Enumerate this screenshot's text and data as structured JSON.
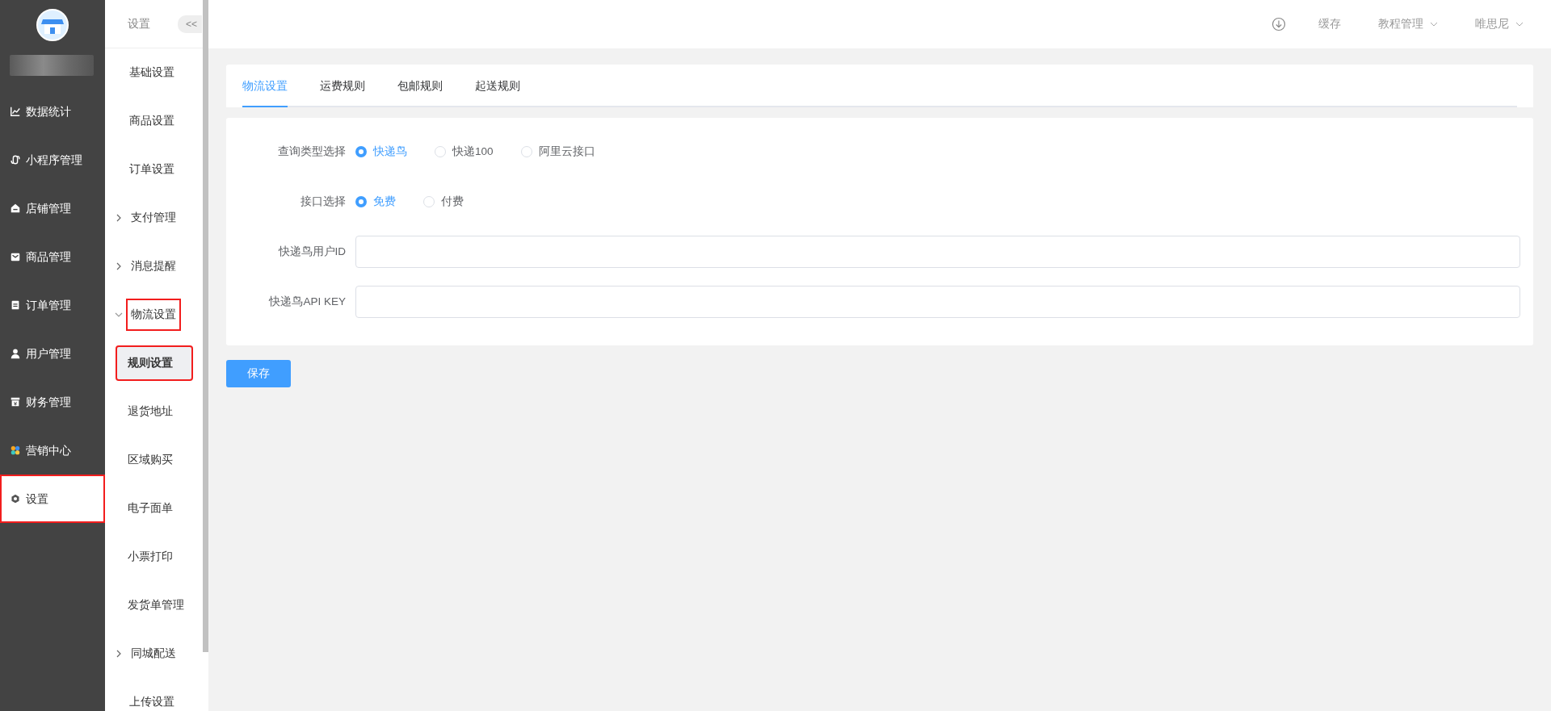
{
  "main_menu": [
    {
      "label": "数据统计",
      "kind": "chart",
      "selected": false,
      "highlighted": false
    },
    {
      "label": "小程序管理",
      "kind": "link",
      "selected": false,
      "highlighted": false
    },
    {
      "label": "店铺管理",
      "kind": "store",
      "selected": false,
      "highlighted": false
    },
    {
      "label": "商品管理",
      "kind": "mail",
      "selected": false,
      "highlighted": false
    },
    {
      "label": "订单管理",
      "kind": "clipboard",
      "selected": false,
      "highlighted": false
    },
    {
      "label": "用户管理",
      "kind": "user",
      "selected": false,
      "highlighted": false
    },
    {
      "label": "财务管理",
      "kind": "finance",
      "selected": false,
      "highlighted": false
    },
    {
      "label": "营销中心",
      "kind": "marketing",
      "selected": false,
      "highlighted": false
    },
    {
      "label": "设置",
      "kind": "settings",
      "selected": true,
      "highlighted": true
    }
  ],
  "sub_menu": {
    "title": "设置",
    "collapse_button": "<<",
    "items": [
      {
        "label": "基础设置",
        "selected": false,
        "highlighted": false
      },
      {
        "label": "商品设置",
        "selected": false,
        "highlighted": false
      },
      {
        "label": "订单设置",
        "selected": false,
        "highlighted": false
      },
      {
        "label": "支付管理",
        "expanded": false,
        "highlighted": false
      },
      {
        "label": "消息提醒",
        "expanded": false,
        "highlighted": false
      },
      {
        "label": "物流设置",
        "expanded": true,
        "highlighted": true,
        "children": [
          {
            "label": "规则设置",
            "selected": true,
            "highlighted": true
          },
          {
            "label": "退货地址",
            "selected": false,
            "highlighted": false
          },
          {
            "label": "区域购买",
            "selected": false,
            "highlighted": false
          },
          {
            "label": "电子面单",
            "selected": false,
            "highlighted": false
          },
          {
            "label": "小票打印",
            "selected": false,
            "highlighted": false
          },
          {
            "label": "发货单管理",
            "selected": false,
            "highlighted": false
          }
        ]
      },
      {
        "label": "同城配送",
        "expanded": false,
        "highlighted": false
      },
      {
        "label": "上传设置",
        "selected": false,
        "highlighted": false
      }
    ]
  },
  "top_bar": {
    "items": [
      {
        "label": "缓存",
        "dropdown": false
      },
      {
        "label": "教程管理",
        "dropdown": true
      },
      {
        "label": "唯思尼",
        "dropdown": true
      }
    ]
  },
  "tabs": [
    {
      "label": "物流设置",
      "selected": true
    },
    {
      "label": "运费规则",
      "selected": false
    },
    {
      "label": "包邮规则",
      "selected": false
    },
    {
      "label": "起送规则",
      "selected": false
    }
  ],
  "form": {
    "rows": [
      {
        "kind": "radio",
        "label": "查询类型选择",
        "options": [
          {
            "label": "快递鸟",
            "selected": true
          },
          {
            "label": "快递100",
            "selected": false
          },
          {
            "label": "阿里云接口",
            "selected": false
          }
        ]
      },
      {
        "kind": "radio",
        "label": "接口选择",
        "options": [
          {
            "label": "免费",
            "selected": true
          },
          {
            "label": "付费",
            "selected": false
          }
        ]
      },
      {
        "kind": "input",
        "label": "快递鸟用户ID"
      },
      {
        "kind": "input",
        "label": "快递鸟API KEY"
      }
    ]
  },
  "save_button": "保存"
}
